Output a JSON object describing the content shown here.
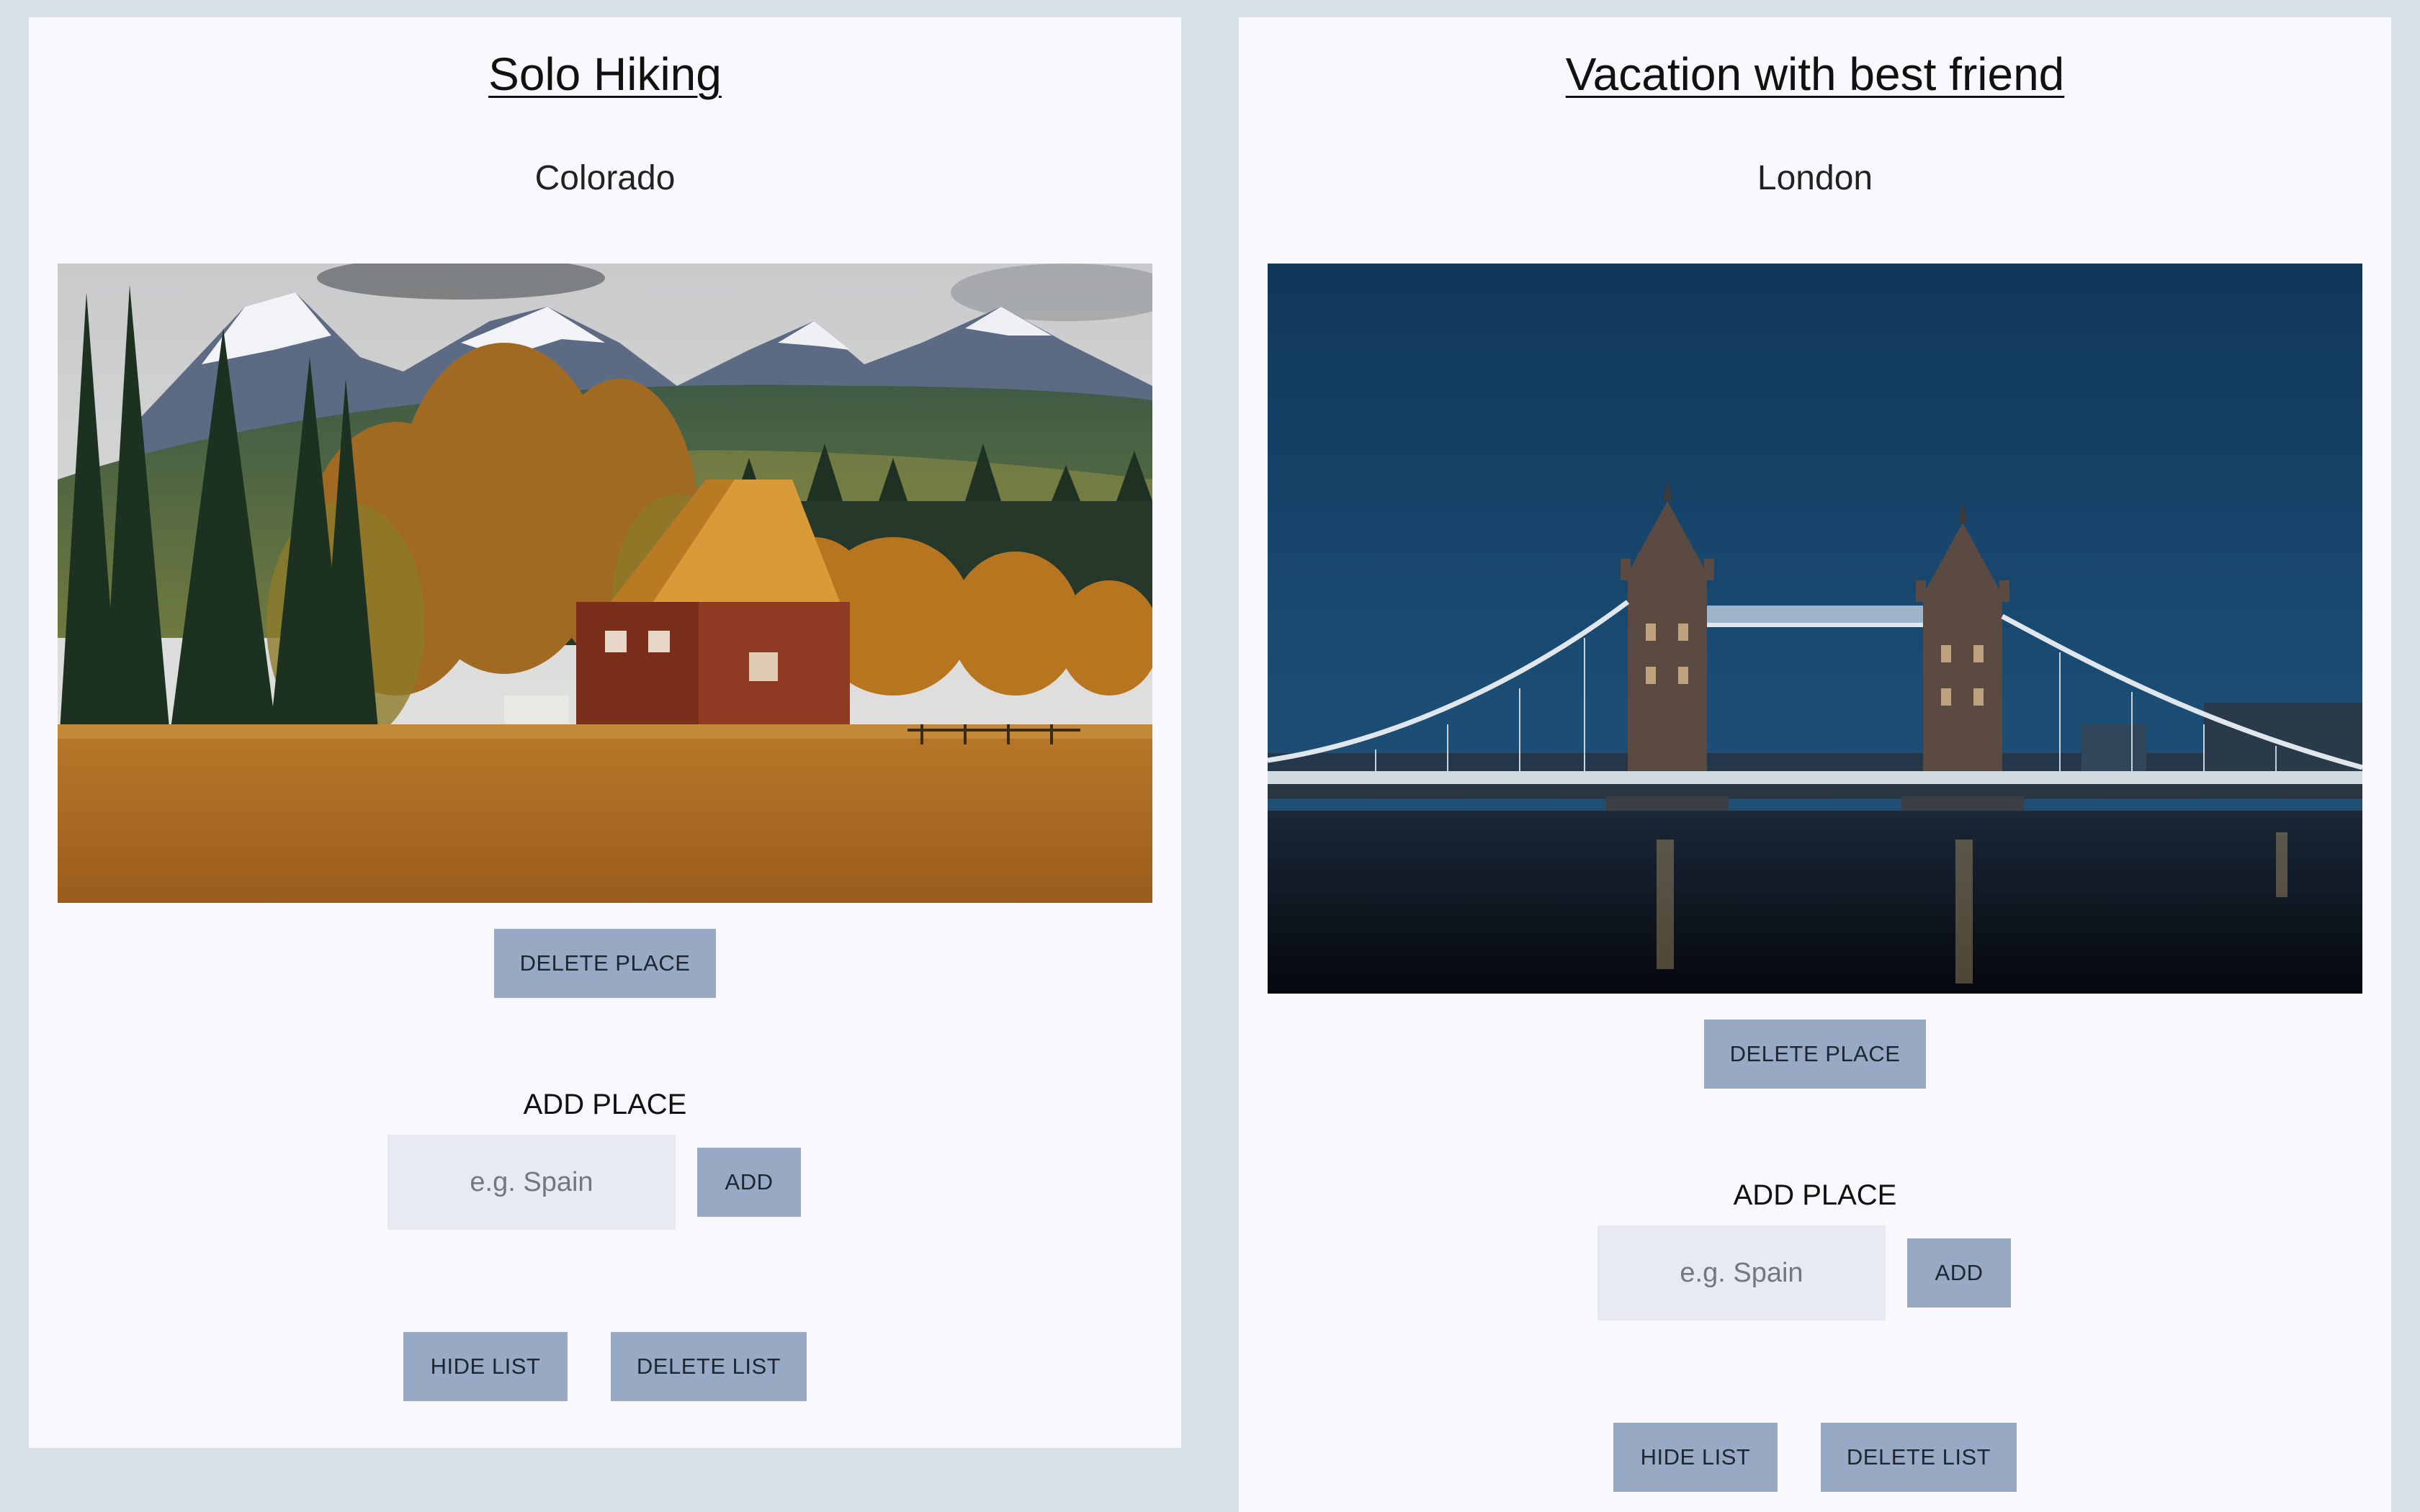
{
  "colors": {
    "page_background": "#d8e0e8",
    "card_background": "#f9f8fd",
    "button_background": "#97a9c3",
    "input_background": "#e7eaf1"
  },
  "lists": [
    {
      "title": "Solo Hiking",
      "place": "Colorado",
      "photo_icon": "mountain-cabin-photo",
      "delete_place_label": "DELETE PLACE",
      "add_place_heading": "ADD PLACE",
      "input_placeholder": "e.g. Spain",
      "input_value": "",
      "add_label": "ADD",
      "hide_list_label": "HIDE LIST",
      "delete_list_label": "DELETE LIST"
    },
    {
      "title": "Vacation with best friend",
      "place": "London",
      "photo_icon": "tower-bridge-photo",
      "delete_place_label": "DELETE PLACE",
      "add_place_heading": "ADD PLACE",
      "input_placeholder": "e.g. Spain",
      "input_value": "",
      "add_label": "ADD",
      "hide_list_label": "HIDE LIST",
      "delete_list_label": "DELETE LIST"
    }
  ]
}
